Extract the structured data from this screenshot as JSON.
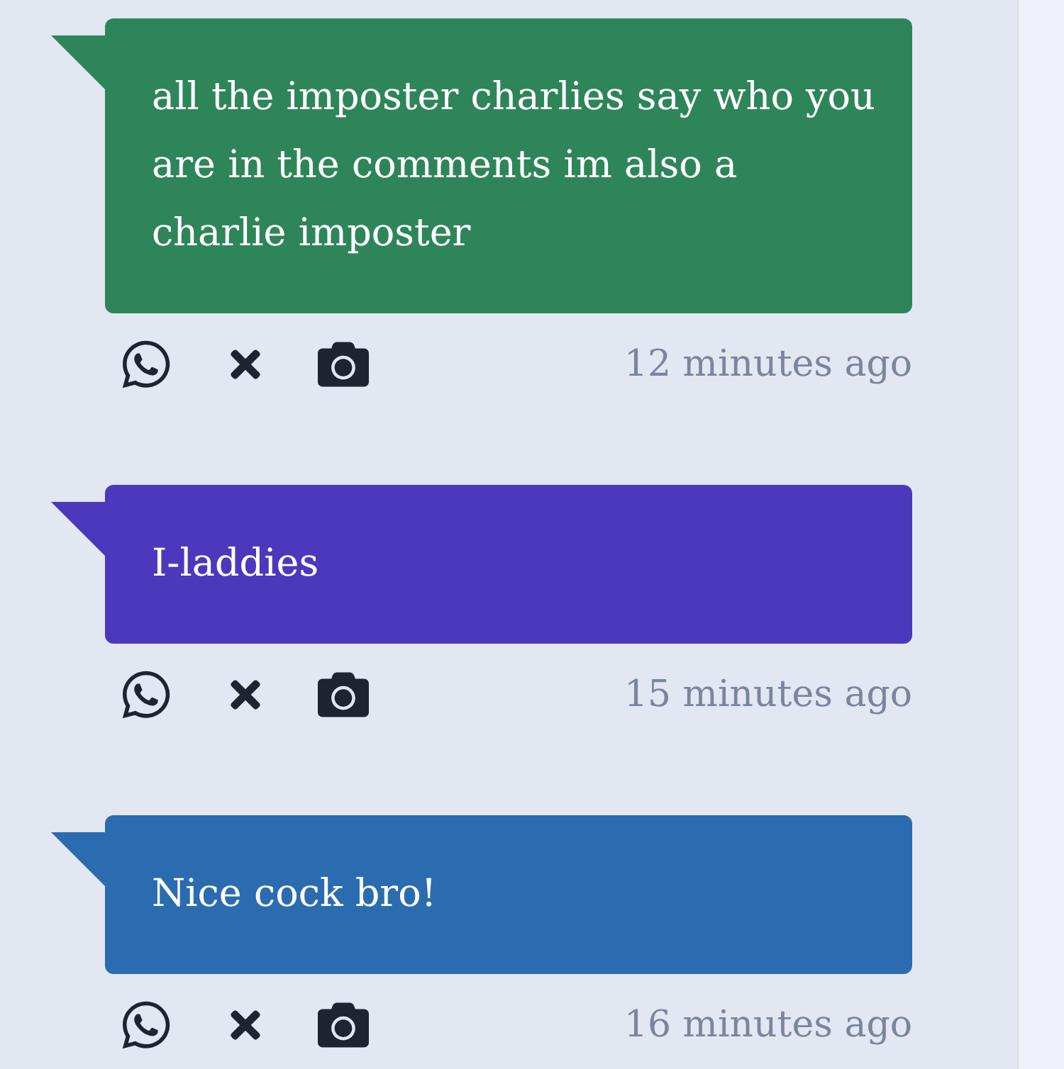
{
  "messages": [
    {
      "text": "all the imposter charlies say who you are in the comments im also a charlie imposter",
      "color": "#2f855a",
      "time": "12 minutes ago"
    },
    {
      "text": "I-laddies",
      "color": "#4c38bd",
      "time": "15 minutes ago"
    },
    {
      "text": "Nice cock bro!",
      "color": "#2b6cb0",
      "time": "16 minutes ago"
    }
  ]
}
